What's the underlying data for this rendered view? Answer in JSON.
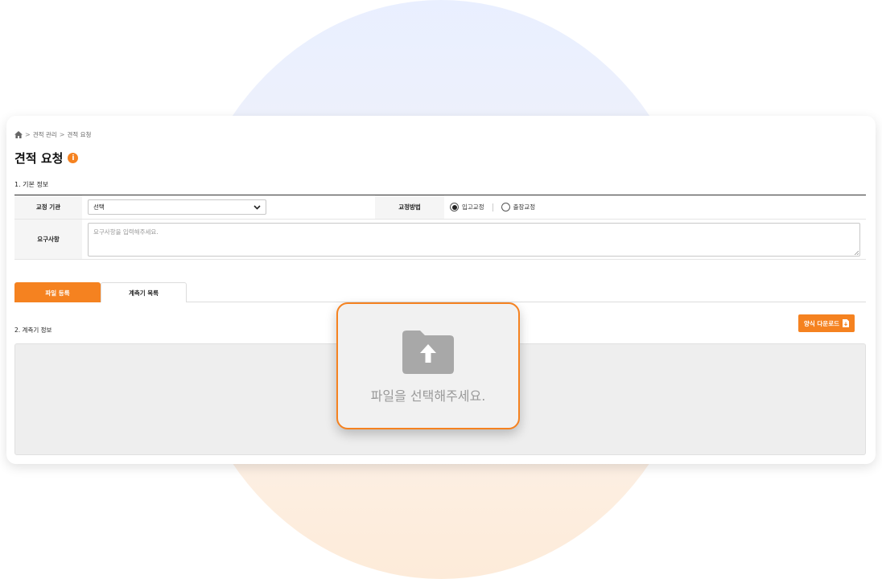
{
  "breadcrumb": {
    "home_icon": "home-icon",
    "items": [
      "견적 관리",
      "견적 요청"
    ],
    "separator": ">"
  },
  "page": {
    "title": "견적 요청",
    "info_icon_glyph": "i"
  },
  "section1": {
    "title": "1. 기본 정보",
    "agency_label": "교정 기관",
    "agency_select_value": "선택",
    "method_label": "교정방법",
    "method_options": [
      {
        "label": "입고교정",
        "checked": true
      },
      {
        "label": "출장교정",
        "checked": false
      }
    ],
    "requirements_label": "요구사항",
    "requirements_placeholder": "요구사항을 입력해주세요."
  },
  "tabs": [
    {
      "label": "파일 등록",
      "active": true
    },
    {
      "label": "계측기 목록",
      "active": false
    }
  ],
  "section2": {
    "title": "2. 계측기 정보",
    "download_label": "양식 다운로드"
  },
  "upload": {
    "text": "파일을 선택해주세요.",
    "icon": "folder-upload-icon"
  },
  "colors": {
    "accent": "#f58220",
    "drop_area": "#eeeeee",
    "upload_icon": "#a8a8a8"
  }
}
